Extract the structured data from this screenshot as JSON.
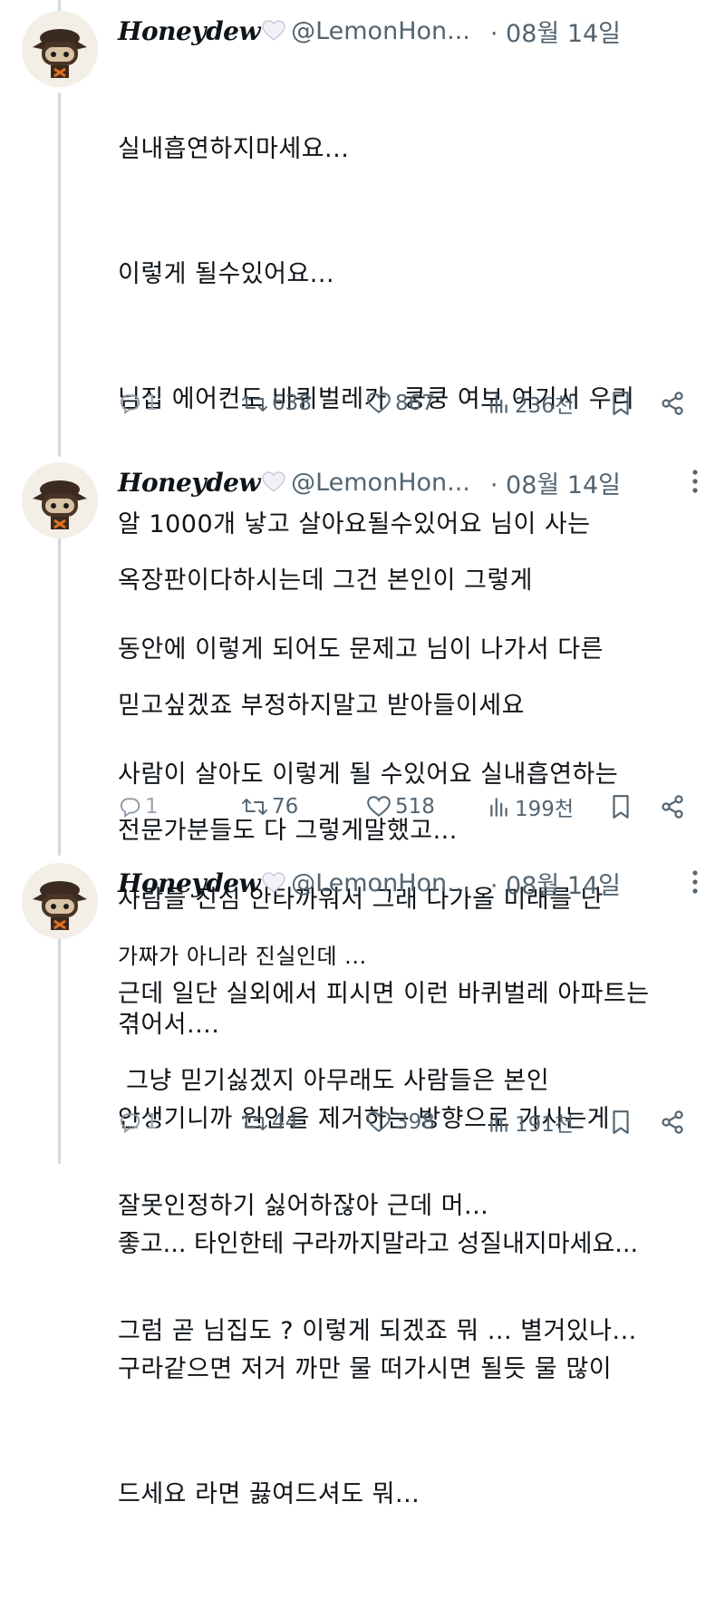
{
  "tweets": [
    {
      "name": "Honeydew",
      "handle": "@LemonHon...",
      "date": "· 08월 14일",
      "lines": [
        "실내흡연하지마세요...",
        "이렇게 될수있어요...",
        "님집 에어컨도 바퀴벌레가  쿵쿵 여보 여기서 우리",
        "알 1000개 낳고 살아요될수있어요 님이 사는",
        "동안에 이렇게 되어도 문제고 님이 나가서 다른",
        "사람이 살아도 이렇게 될 수있어요 실내흡연하는",
        "사람들 진심 안타까워서 그래 다가올 미래를 난",
        "겪어서...."
      ],
      "replies": "1",
      "retweets": "638",
      "likes": "867",
      "views": "236천"
    },
    {
      "name": "Honeydew",
      "handle": "@LemonHon...",
      "date": "· 08월 14일",
      "lines": [
        "옥장판이다하시는데 그건 본인이 그렇게",
        "믿고싶겠죠 부정하지말고 받아들이세요",
        "전문가분들도 다 그렇게말했고...",
        "가짜가 아니라 진실인데 ...",
        " 그냥 믿기싫겠지 아무래도 사람들은 본인",
        "잘못인정하기 싫어하잖아 근데 머...",
        "그럼 곧 님집도 ? 이렇게 되겠죠 뭐 ... 별거있나..."
      ],
      "replies": "1",
      "retweets": "76",
      "likes": "518",
      "views": "199천"
    },
    {
      "name": "Honeydew",
      "handle": "@LemonHon...",
      "date": "· 08월 14일",
      "lines": [
        "근데 일단 실외에서 피시면 이런 바퀴벌레 아파트는",
        "안생기니까 원인을 제거하는 방향으로 가시는게",
        "좋고... 타인한테 구라까지말라고 성질내지마세요...",
        "구라같으면 저거 까만 물 떠가시면 될듯 물 많이",
        "드세요 라면 끓여드셔도 뭐..."
      ],
      "replies": "1",
      "retweets": "44",
      "likes": "398",
      "views": "191천"
    }
  ],
  "icons": {
    "reply": "reply-icon",
    "retweet": "retweet-icon",
    "like": "like-icon",
    "views": "views-icon",
    "bookmark": "bookmark-icon",
    "share": "share-icon",
    "more": "more-icon",
    "heart": "white-heart-emoji"
  },
  "colors": {
    "text": "#0f1419",
    "muted": "#536471",
    "thread": "#cfd9de",
    "accent": "#1d9bf0"
  }
}
